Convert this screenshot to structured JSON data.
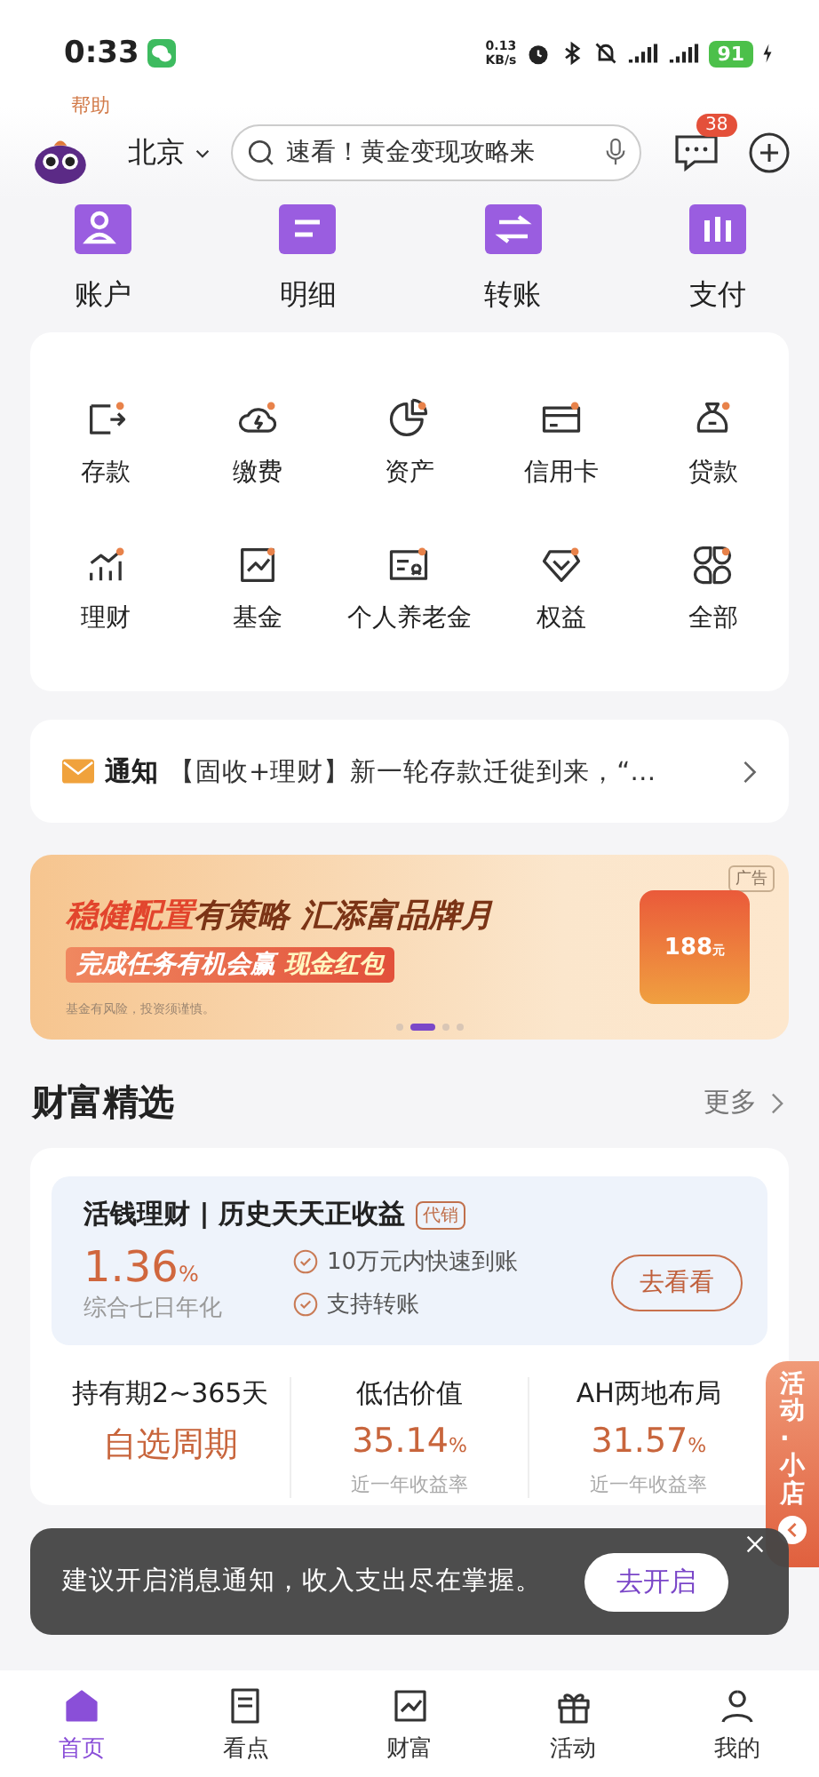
{
  "status_bar": {
    "time": "0:33",
    "net_speed": "0.13",
    "net_unit": "KB/s",
    "battery": "91"
  },
  "header": {
    "help_label": "帮助",
    "city": "北京",
    "search": {
      "placeholder": "速看！黄金变现攻略来"
    },
    "message_badge": "38"
  },
  "quick_actions": [
    {
      "label": "账户"
    },
    {
      "label": "明细"
    },
    {
      "label": "转账"
    },
    {
      "label": "支付"
    }
  ],
  "services": [
    {
      "label": "存款"
    },
    {
      "label": "缴费"
    },
    {
      "label": "资产"
    },
    {
      "label": "信用卡"
    },
    {
      "label": "贷款"
    },
    {
      "label": "理财"
    },
    {
      "label": "基金"
    },
    {
      "label": "个人养老金"
    },
    {
      "label": "权益"
    },
    {
      "label": "全部"
    }
  ],
  "notice": {
    "tag": "通知",
    "text": "【固收+理财】新一轮存款迁徙到来，“…"
  },
  "banner": {
    "badge": "广告",
    "headline_highlight": "稳健配置",
    "headline_rest": "有策略 汇添富品牌月",
    "subline": "完成任务有机会赢",
    "subline_highlight": "现金红包",
    "amount": "188",
    "amount_unit": "元",
    "disclaimer": "基金有风险，投资须谨慎。",
    "pages": [
      {
        "selected": false
      },
      {
        "selected": true
      },
      {
        "selected": false
      },
      {
        "selected": false
      }
    ]
  },
  "section": {
    "title": "财富精选",
    "more": "更多"
  },
  "featured": {
    "title": "活钱理财 | 历史天天正收益",
    "tag": "代销",
    "rate": "1.36",
    "rate_unit": "%",
    "rate_label": "综合七日年化",
    "features": [
      "10万元内快速到账",
      "支持转账"
    ],
    "button": "去看看"
  },
  "products": [
    {
      "title": "持有期2~365天",
      "value": "自选周期"
    },
    {
      "title": "低估价值",
      "value": "35.14",
      "unit": "%",
      "caption": "近一年收益率"
    },
    {
      "title": "AH两地布局",
      "value": "31.57",
      "unit": "%",
      "caption": "近一年收益率"
    }
  ],
  "float_tab": {
    "label": "活动·小店"
  },
  "toast": {
    "text": "建议开启消息通知，收入支出尽在掌握。",
    "button": "去开启"
  },
  "tab_bar": [
    {
      "label": "首页",
      "selected": true
    },
    {
      "label": "看点",
      "selected": false
    },
    {
      "label": "财富",
      "selected": false
    },
    {
      "label": "活动",
      "selected": false
    },
    {
      "label": "我的",
      "selected": false
    }
  ]
}
